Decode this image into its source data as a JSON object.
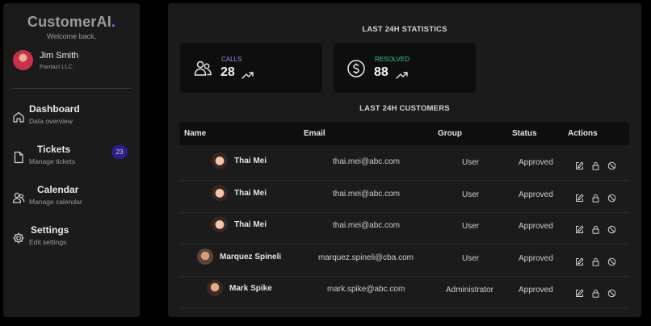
{
  "app": {
    "logo": "CustomerAI",
    "logo_dot": "."
  },
  "sidebar": {
    "welcome": "Welcome back,",
    "user": {
      "name": "Jim Smith",
      "org": "Pantazi LLC"
    },
    "items": [
      {
        "title": "Dashboard",
        "subtitle": "Data overview",
        "icon": "home-icon"
      },
      {
        "title": "Tickets",
        "subtitle": "Manage tickets",
        "icon": "document-icon",
        "badge": "23"
      },
      {
        "title": "Calendar",
        "subtitle": "Manage calendar",
        "icon": "users-icon"
      },
      {
        "title": "Settings",
        "subtitle": "Edit settings",
        "icon": "gear-icon"
      }
    ]
  },
  "stats": {
    "title": "LAST 24H STATISTICS",
    "cards": [
      {
        "label": "CALLS",
        "value": "28",
        "label_color": "#9b8cf5",
        "icon": "users-icon"
      },
      {
        "label": "RESOLVED",
        "value": "88",
        "label_color": "#3fc47a",
        "icon": "dollar-icon"
      }
    ]
  },
  "customers": {
    "title": "LAST 24H CUSTOMERS",
    "columns": [
      "Name",
      "Email",
      "Group",
      "Status",
      "Actions"
    ],
    "rows": [
      {
        "name": "Thai Mei",
        "email": "thai.mei@abc.com",
        "group": "User",
        "status": "Approved",
        "avatar": "f"
      },
      {
        "name": "Thai Mei",
        "email": "thai.mei@abc.com",
        "group": "User",
        "status": "Approved",
        "avatar": "f"
      },
      {
        "name": "Thai Mei",
        "email": "thai.mei@abc.com",
        "group": "User",
        "status": "Approved",
        "avatar": "f"
      },
      {
        "name": "Marquez Spineli",
        "email": "marquez.spineli@cba.com",
        "group": "User",
        "status": "Approved",
        "avatar": "m"
      },
      {
        "name": "Mark Spike",
        "email": "mark.spike@abc.com",
        "group": "Administrator",
        "status": "Approved",
        "avatar": "s"
      }
    ]
  }
}
